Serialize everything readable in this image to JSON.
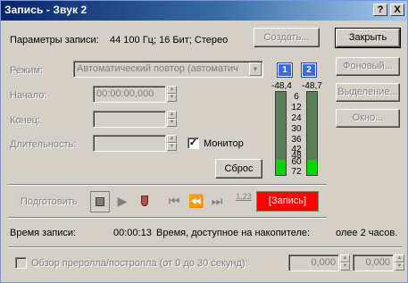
{
  "window": {
    "title": "Запись - Звук 2",
    "help_btn": "?",
    "close_btn": "X"
  },
  "params": {
    "label": "Параметры записи:",
    "value": "44 100 Гц; 16 Бит; Стерео"
  },
  "buttons": {
    "create": "Создать...",
    "close": "Закрыть",
    "background": "Фоновый...",
    "selection": "Выделение...",
    "window": "Окно...",
    "reset": "Сброс"
  },
  "mode": {
    "label": "Режим:",
    "value": "Автоматический повтор (автоматич"
  },
  "start": {
    "label": "Начало:",
    "value": "00:00:00,000"
  },
  "end": {
    "label": "Конец:",
    "value": ""
  },
  "duration": {
    "label": "Длительность:",
    "value": ""
  },
  "monitor": {
    "label": "Монитор",
    "checked": true
  },
  "meters": {
    "channels": [
      "1",
      "2"
    ],
    "peaks": [
      "-48,4",
      "-48,7"
    ],
    "scale": [
      "6",
      "12",
      "24",
      "30",
      "36",
      "42",
      "48",
      "60",
      "72"
    ],
    "levels": [
      0.18,
      0.18
    ]
  },
  "transport": {
    "prepare_label": "Подготовить",
    "counter_label": "1,23",
    "record_label": "[Запись]"
  },
  "status": {
    "rec_time_label": "Время записи:",
    "rec_time_value": "00:00:13",
    "avail_label": "Время, доступное на накопителе:",
    "avail_value": "олее 2 часов."
  },
  "preroll": {
    "label": "Обзор преролла/постролла (от 0 до 30 секунд):",
    "pre_value": "0,000",
    "post_value": "0,000"
  },
  "colors": {
    "title_start": "#0a246a",
    "title_end": "#a6caf0",
    "record": "#ff0000",
    "meter_green": "#00d800",
    "channel": "#3a6cd8"
  }
}
